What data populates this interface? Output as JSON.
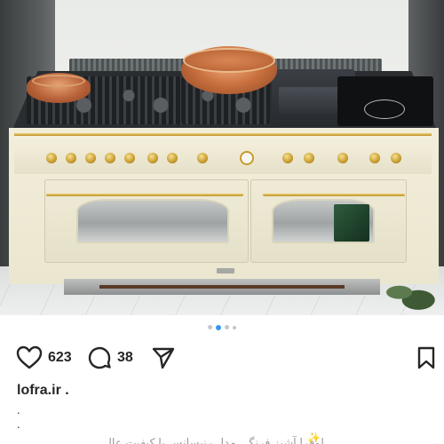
{
  "post": {
    "image_alt": "Cream and brass Lofra range with copper pots on the cooktop",
    "carousel": {
      "count": 4,
      "active_index": 1
    },
    "actions": {
      "like_icon": "heart-icon",
      "likes_count": "623",
      "comment_icon": "comment-bubble-icon",
      "comments_count": "38",
      "share_icon": "paper-plane-icon",
      "save_icon": "bookmark-icon"
    },
    "caption": {
      "username": "lofra.ir .",
      "line1": ".",
      "line2": ".",
      "truncated_line": "لوفرا آشپز فرنگی مدل رنیسانس با کیفیت عالی",
      "emoji": "✨"
    },
    "colors": {
      "accent_blue": "#3897f0",
      "text": "#262626",
      "brass": "#c79b2f",
      "cream": "#f2eeda"
    }
  }
}
